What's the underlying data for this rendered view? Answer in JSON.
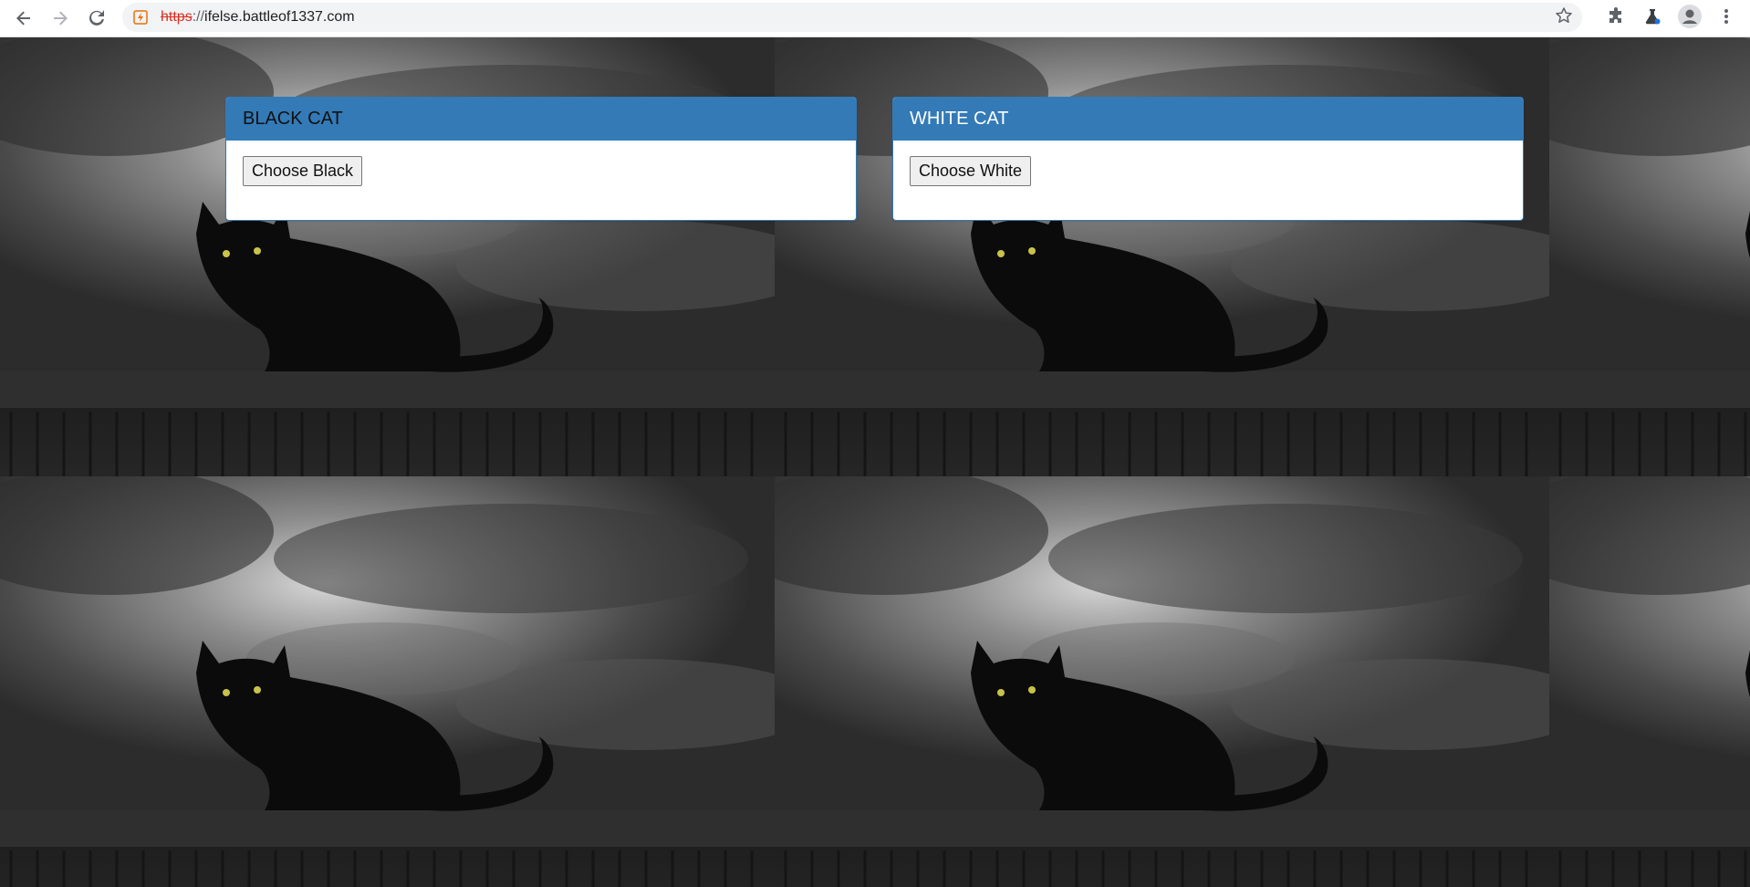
{
  "browser": {
    "url_scheme": "https",
    "url_separator": "://",
    "url_host": "ifelse.battleof1337.com",
    "icons": {
      "back": "back-arrow-icon",
      "forward": "forward-arrow-icon",
      "reload": "reload-icon",
      "site": "site-info-icon",
      "bookmark": "star-icon",
      "extensions": "puzzle-icon",
      "labs": "flask-icon",
      "profile": "avatar-icon",
      "menu": "kebab-menu-icon"
    }
  },
  "panels": [
    {
      "title": "BLACK CAT",
      "button_label": "Choose Black"
    },
    {
      "title": "WHITE CAT",
      "button_label": "Choose White"
    }
  ],
  "colors": {
    "panel_header": "#337ab7",
    "url_scheme_insecure": "#d93025"
  }
}
